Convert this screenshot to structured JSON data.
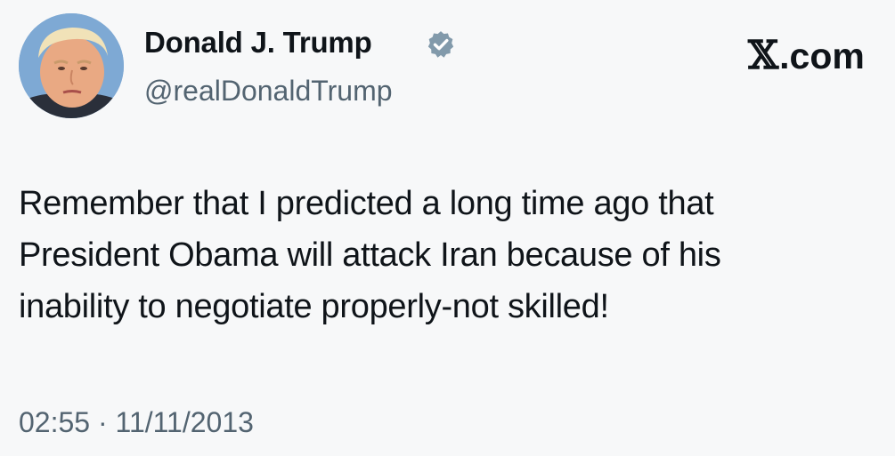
{
  "user": {
    "display_name": "Donald J. Trump",
    "handle": "@realDonaldTrump",
    "verified": true
  },
  "brand": {
    "x_glyph": "𝕏",
    "label": ".com"
  },
  "tweet": {
    "text": "Remember that I predicted a long time ago that\nPresident Obama will attack Iran because of his\ninability to negotiate properly-not skilled!",
    "time": "02:55",
    "separator": "·",
    "date": "11/11/2013"
  },
  "icons": {
    "verified": "verified-badge-icon",
    "avatar": "profile-photo"
  },
  "colors": {
    "background": "#f7f8f9",
    "text_primary": "#0f1419",
    "text_secondary": "#536471",
    "verified_badge": "#829aab"
  }
}
